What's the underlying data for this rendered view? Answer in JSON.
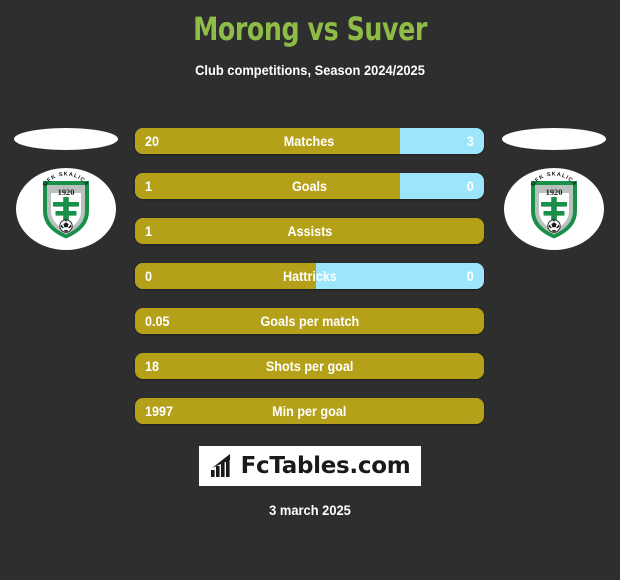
{
  "header": {
    "title": "Morong vs Suver",
    "subtitle": "Club competitions, Season 2024/2025",
    "title_color": "#8fbc46"
  },
  "colors": {
    "background": "#2e2e2e",
    "home_bar": "#b5a119",
    "away_bar": "#9de5fb",
    "text": "#ffffff"
  },
  "teams": {
    "home": {
      "badge_name": "MFK SKALICA",
      "badge_year": "1920"
    },
    "away": {
      "badge_name": "MFK SKALICA",
      "badge_year": "1920"
    }
  },
  "stats": [
    {
      "label": "Matches",
      "home": "20",
      "away": "3",
      "home_pct": 76,
      "split": true
    },
    {
      "label": "Goals",
      "home": "1",
      "away": "0",
      "home_pct": 76,
      "split": true
    },
    {
      "label": "Assists",
      "home": "1",
      "away": "",
      "home_pct": 100,
      "split": false
    },
    {
      "label": "Hattricks",
      "home": "0",
      "away": "0",
      "home_pct": 52,
      "split": true
    },
    {
      "label": "Goals per match",
      "home": "0.05",
      "away": "",
      "home_pct": 100,
      "split": false
    },
    {
      "label": "Shots per goal",
      "home": "18",
      "away": "",
      "home_pct": 100,
      "split": false
    },
    {
      "label": "Min per goal",
      "home": "1997",
      "away": "",
      "home_pct": 100,
      "split": false
    }
  ],
  "footer": {
    "logo_text": "FcTables.com",
    "date": "3 march 2025"
  }
}
